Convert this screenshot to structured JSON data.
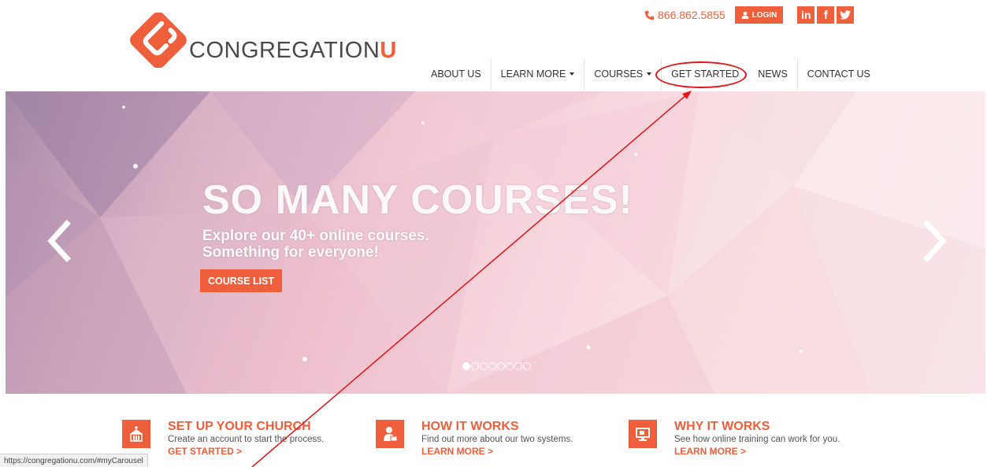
{
  "brand": {
    "logo_text_main": "CONGREGATION",
    "logo_text_accent": "U",
    "accent_color": "#ef5f3c"
  },
  "header": {
    "phone": "866.862.5855",
    "login_label": "LOGIN",
    "social": [
      {
        "icon": "linkedin-icon",
        "glyph": "in"
      },
      {
        "icon": "facebook-icon",
        "glyph": "f"
      },
      {
        "icon": "twitter-icon",
        "glyph": "t"
      }
    ]
  },
  "nav": {
    "items": [
      {
        "label": "ABOUT US",
        "dropdown": false
      },
      {
        "label": "LEARN MORE",
        "dropdown": true
      },
      {
        "label": "COURSES",
        "dropdown": true
      },
      {
        "label": "GET STARTED",
        "dropdown": false
      },
      {
        "label": "NEWS",
        "dropdown": false
      },
      {
        "label": "CONTACT US",
        "dropdown": false
      }
    ]
  },
  "carousel": {
    "headline": "SO MANY COURSES!",
    "subline_1": "Explore our 40+ online courses.",
    "subline_2": "Something for everyone!",
    "button_label": "COURSE LIST",
    "slide_count": 8,
    "active_slide": 1
  },
  "features": [
    {
      "icon": "church-icon",
      "title": "SET UP YOUR CHURCH",
      "desc": "Create an account to start the process.",
      "link": "GET STARTED >"
    },
    {
      "icon": "person-laptop-icon",
      "title": "HOW IT WORKS",
      "desc": "Find out more about our two systems.",
      "link": "LEARN MORE >"
    },
    {
      "icon": "monitor-icon",
      "title": "WHY IT WORKS",
      "desc": "See how online training can work for you.",
      "link": "LEARN MORE >"
    }
  ],
  "status_bar": {
    "url": "https://congregationu.com/#myCarousel"
  }
}
